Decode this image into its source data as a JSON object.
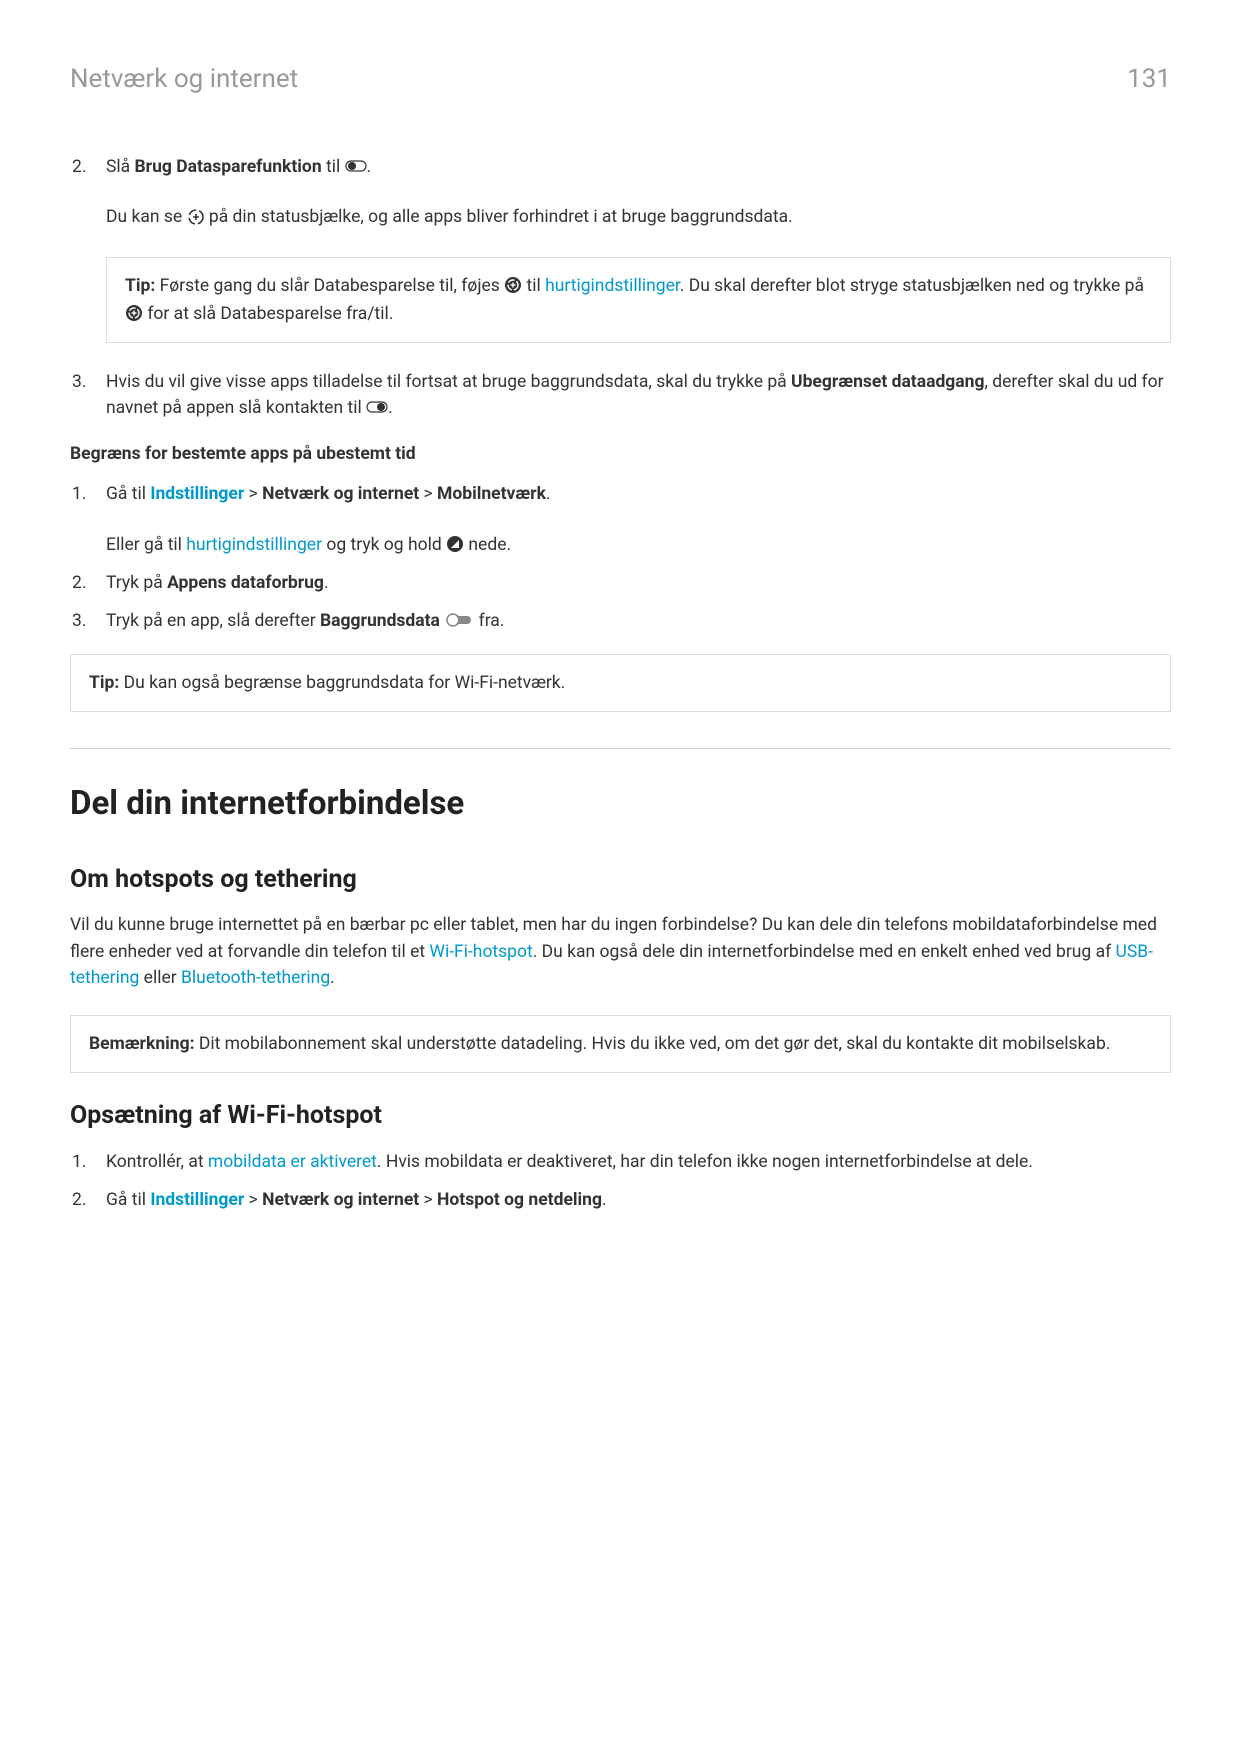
{
  "header": {
    "title": "Netværk og internet",
    "page": "131"
  },
  "list1": {
    "item2": {
      "num": "2.",
      "t1": "Slå ",
      "t2": "Brug Datasparefunktion",
      "t3": " til ",
      "t4": ".",
      "sub1a": "Du kan se ",
      "sub1b": " på din statusbjælke, og alle apps bliver forhindret i at bruge baggrundsdata."
    },
    "tip": {
      "label": "Tip:",
      "t1": " Første gang du slår Databesparelse til, føjes ",
      "t2": " til ",
      "link1": "hurtigindstillinger",
      "t3": ". Du skal derefter blot stryge statusbjælken ned og trykke på ",
      "t4": " for at slå Databesparelse fra/til."
    },
    "item3": {
      "num": "3.",
      "t1": "Hvis du vil give visse apps tilladelse til fortsat at bruge baggrundsdata, skal du trykke på ",
      "t2": "Ubegrænset dataadgang",
      "t3": ", derefter skal du ud for navnet på appen slå kontakten til ",
      "t4": "."
    }
  },
  "sectionSub": "Begræns for bestemte apps på ubestemt tid",
  "list2": {
    "item1": {
      "num": "1.",
      "t1": "Gå til ",
      "link1": "Indstillinger",
      "t2": " > ",
      "b1": "Netværk og internet",
      "t3": " > ",
      "b2": "Mobilnetværk",
      "t4": ".",
      "sub1a": "Eller gå til ",
      "sub1link": "hurtigindstillinger",
      "sub1b": " og tryk og hold ",
      "sub1c": " nede."
    },
    "item2": {
      "num": "2.",
      "t1": "Tryk på ",
      "b1": "Appens dataforbrug",
      "t2": "."
    },
    "item3": {
      "num": "3.",
      "t1": "Tryk på en app, slå derefter ",
      "b1": "Baggrundsdata",
      "t2": " ",
      "t3": " fra."
    }
  },
  "tip2": {
    "label": "Tip:",
    "t1": " Du kan også begrænse baggrundsdata for Wi-Fi-netværk."
  },
  "h1": "Del din internetforbindelse",
  "h2a": "Om hotspots og tethering",
  "para1": {
    "t1": "Vil du kunne bruge internettet på en bærbar pc eller tablet, men har du ingen forbindelse? Du kan dele din telefons mobildataforbindelse med flere enheder ved at forvandle din telefon til et ",
    "link1": "Wi-Fi-hotspot",
    "t2": ". Du kan også dele din internetforbindelse med en enkelt enhed ved brug af ",
    "link2": "USB-tethering",
    "t3": " eller ",
    "link3": "Bluetooth-tethering",
    "t4": "."
  },
  "note": {
    "label": "Bemærkning:",
    "t1": " Dit mobilabonnement skal understøtte datadeling. Hvis du ikke ved, om det gør det, skal du kontakte dit mobilselskab."
  },
  "h2b": "Opsætning af Wi-Fi-hotspot",
  "list3": {
    "item1": {
      "num": "1.",
      "t1": "Kontrollér, at ",
      "link1": "mobildata er aktiveret",
      "t2": ". Hvis mobildata er deaktiveret, har din telefon ikke nogen internetforbindelse at dele."
    },
    "item2": {
      "num": "2.",
      "t1": "Gå til ",
      "link1": "Indstillinger",
      "t2": " > ",
      "b1": "Netværk og internet",
      "t3": " > ",
      "b2": "Hotspot og netdeling",
      "t4": "."
    }
  }
}
